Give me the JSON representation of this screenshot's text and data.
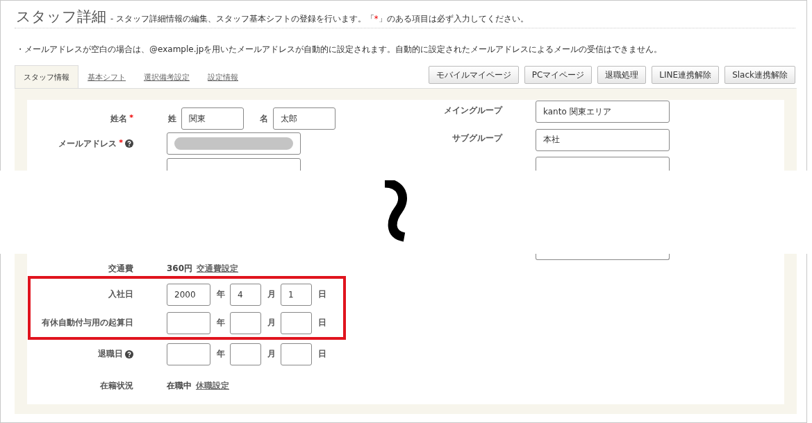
{
  "header": {
    "title": "スタッフ詳細",
    "subtitle": [
      {
        "text": "- スタッフ詳細情報の編集、スタッフ基本シフトの登録を行います。「",
        "kind": "plain"
      },
      {
        "text": "*",
        "kind": "required"
      },
      {
        "text": "」のある項目は必ず入力してください。",
        "kind": "plain"
      }
    ]
  },
  "notice": "・メールアドレスが空白の場合は、@example.jpを用いたメールアドレスが自動的に設定されます。自動的に設定されたメールアドレスによるメールの受信はできません。",
  "tabs": [
    {
      "label": "スタッフ情報",
      "selected": true
    },
    {
      "label": "基本シフト",
      "selected": false
    },
    {
      "label": "選択備考設定",
      "selected": false
    },
    {
      "label": "設定情報",
      "selected": false
    }
  ],
  "actions": [
    "モバイルマイページ",
    "PCマイページ",
    "退職処理",
    "LINE連携解除",
    "Slack連携解除"
  ],
  "upper_form": {
    "left": [
      {
        "kind": "name",
        "label": "姓名",
        "required": true,
        "help": false,
        "parts": [
          {
            "label": "姓",
            "value": "関東"
          },
          {
            "label": "名",
            "value": "太郎"
          }
        ]
      },
      {
        "kind": "email",
        "label": "メールアドレス",
        "required": true,
        "help": true,
        "redacted": true
      },
      {
        "kind": "cut"
      }
    ],
    "right": [
      {
        "kind": "field",
        "label": "メイングループ",
        "value": "kanto 関東エリア"
      },
      {
        "kind": "field",
        "label": "サブグループ",
        "value": "本社"
      },
      {
        "kind": "cut"
      }
    ]
  },
  "lower_form": [
    {
      "kind": "value",
      "label": "交通費",
      "help": false,
      "highlighted": false,
      "value": "360円",
      "link": "交通費設定"
    },
    {
      "kind": "date",
      "label": "入社日",
      "help": false,
      "highlighted": true,
      "year": "2000",
      "year_unit": "年",
      "month": "4",
      "month_unit": "月",
      "day": "1",
      "day_unit": "日"
    },
    {
      "kind": "date",
      "label": "有休自動付与用の起算日",
      "help": false,
      "highlighted": true,
      "year_unit": "年",
      "month_unit": "月",
      "day_unit": "日"
    },
    {
      "kind": "date",
      "label": "退職日",
      "help": true,
      "highlighted": false,
      "year_unit": "年",
      "month_unit": "月",
      "day_unit": "日"
    },
    {
      "kind": "value",
      "label": "在籍状況",
      "help": false,
      "highlighted": false,
      "value": "在職中",
      "link": "休職設定"
    }
  ]
}
